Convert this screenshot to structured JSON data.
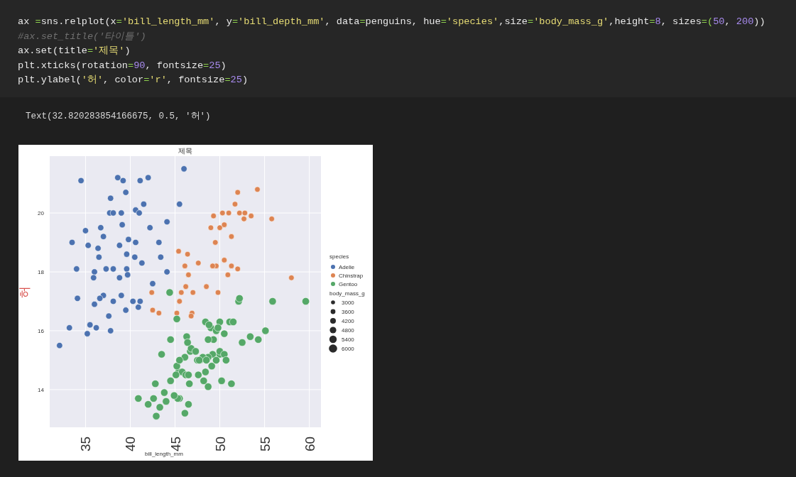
{
  "code_cell": {
    "lines": [
      [
        {
          "kind": "name",
          "text": "ax "
        },
        {
          "kind": "op",
          "text": "="
        },
        {
          "kind": "name",
          "text": "sns.relplot(x"
        },
        {
          "kind": "op",
          "text": "="
        },
        {
          "kind": "string",
          "text": "'bill_length_mm'"
        },
        {
          "kind": "name",
          "text": ", y"
        },
        {
          "kind": "op",
          "text": "="
        },
        {
          "kind": "string",
          "text": "'bill_depth_mm'"
        },
        {
          "kind": "name",
          "text": ", data"
        },
        {
          "kind": "op",
          "text": "="
        },
        {
          "kind": "name",
          "text": "penguins, hue"
        },
        {
          "kind": "op",
          "text": "="
        },
        {
          "kind": "string",
          "text": "'species'"
        },
        {
          "kind": "name",
          "text": ",size"
        },
        {
          "kind": "op",
          "text": "="
        },
        {
          "kind": "string",
          "text": "'body_mass_g'"
        },
        {
          "kind": "name",
          "text": ",height"
        },
        {
          "kind": "op",
          "text": "="
        },
        {
          "kind": "number",
          "text": "8"
        },
        {
          "kind": "name",
          "text": ", sizes"
        },
        {
          "kind": "op",
          "text": "=("
        },
        {
          "kind": "number",
          "text": "50"
        },
        {
          "kind": "name",
          "text": ", "
        },
        {
          "kind": "number",
          "text": "200"
        },
        {
          "kind": "name",
          "text": "))"
        }
      ],
      [
        {
          "kind": "comment",
          "text": "#ax.set_title('타이틀')"
        }
      ],
      [
        {
          "kind": "name",
          "text": "ax.set(title"
        },
        {
          "kind": "op",
          "text": "="
        },
        {
          "kind": "string",
          "text": "'제목'"
        },
        {
          "kind": "name",
          "text": ")"
        }
      ],
      [
        {
          "kind": "name",
          "text": "plt.xticks(rotation"
        },
        {
          "kind": "op",
          "text": "="
        },
        {
          "kind": "number",
          "text": "90"
        },
        {
          "kind": "name",
          "text": ", fontsize"
        },
        {
          "kind": "op",
          "text": "="
        },
        {
          "kind": "number",
          "text": "25"
        },
        {
          "kind": "name",
          "text": ")"
        }
      ],
      [
        {
          "kind": "name",
          "text": "plt.ylabel("
        },
        {
          "kind": "string",
          "text": "'허'"
        },
        {
          "kind": "name",
          "text": ", color"
        },
        {
          "kind": "op",
          "text": "="
        },
        {
          "kind": "string",
          "text": "'r'"
        },
        {
          "kind": "name",
          "text": ", fontsize"
        },
        {
          "kind": "op",
          "text": "="
        },
        {
          "kind": "number",
          "text": "25"
        },
        {
          "kind": "name",
          "text": ")"
        }
      ]
    ]
  },
  "output": {
    "text": "Text(32.820283854166675, 0.5, '허')"
  },
  "figure": {
    "chart_data": {
      "type": "scatter",
      "title": "제목",
      "xlabel": "bill_length_mm",
      "ylabel": "허",
      "xlim": [
        31,
        61.3
      ],
      "ylim": [
        12.72,
        21.93
      ],
      "xticks": [
        35,
        40,
        45,
        50,
        55,
        60
      ],
      "yticks": [
        14,
        16,
        18,
        20
      ],
      "grid": true,
      "legend": "right",
      "series": [
        {
          "name": "Adelie",
          "color": "#4c72b0",
          "x": [
            34.5,
            39.2,
            38.6,
            41.1,
            42,
            46,
            37.8,
            39.5,
            40.6,
            41.5,
            37.7,
            38.1,
            39,
            41,
            45.5,
            44.1,
            35,
            36.7,
            39.1,
            42.2,
            33.5,
            35.3,
            36.4,
            38.8,
            39.8,
            40.6,
            43.2,
            34,
            36,
            36.5,
            37.3,
            38.1,
            39.6,
            40.5,
            41.3,
            43.4,
            44.1,
            35.9,
            37,
            38.8,
            39.7,
            40.3,
            42.5,
            36,
            37.6,
            39.5,
            41.1,
            33.2,
            35.5,
            36.2,
            37.8,
            35.2,
            32.1,
            38.1,
            36.6,
            39,
            40.9,
            34.1,
            37,
            39.6
          ],
          "values": [
            21.1,
            21.1,
            21.2,
            21.1,
            21.2,
            21.5,
            20.5,
            20.7,
            20.1,
            20.3,
            20,
            20,
            20,
            20,
            20.3,
            19.7,
            19.4,
            19.5,
            19.6,
            19.5,
            19,
            18.9,
            18.8,
            18.9,
            19.1,
            19,
            19,
            18.1,
            18,
            18.5,
            18.1,
            18.1,
            18.1,
            18.5,
            18.3,
            18.5,
            18,
            17.8,
            17.2,
            17.8,
            17.9,
            17,
            17.6,
            16.9,
            16.5,
            16.7,
            17,
            16.1,
            16.2,
            16.1,
            16,
            15.9,
            15.5,
            17,
            17.1,
            17.2,
            16.8,
            17.1,
            19.2,
            18.6
          ]
        },
        {
          "name": "Chinstrap",
          "color": "#dd8452",
          "x": [
            46.5,
            50,
            51.3,
            52.7,
            45.4,
            46.1,
            51.3,
            52.2,
            54.2,
            49.6,
            47,
            50.5,
            49.5,
            46.4,
            52,
            50.5,
            49.2,
            46.9,
            58,
            55.8,
            52,
            51,
            50.9,
            45.2,
            42.5,
            43.2,
            46.2,
            48.5,
            50.3,
            49,
            52.8,
            47.6,
            45.7,
            51.7,
            53.5,
            49.8,
            42.4,
            45.5,
            46.8,
            49.3
          ],
          "values": [
            17.9,
            19.5,
            19.2,
            19.8,
            18.7,
            18.2,
            18.2,
            20,
            20.8,
            18.2,
            17.3,
            19.6,
            19,
            18.6,
            18.1,
            18.4,
            18.2,
            16.6,
            17.8,
            19.8,
            20.7,
            20,
            17.9,
            16.6,
            16.7,
            16.6,
            17.5,
            17.5,
            20,
            19.5,
            20,
            18.3,
            17.3,
            20.3,
            19.9,
            17.3,
            17.3,
            17,
            16.5,
            19.9
          ]
        },
        {
          "name": "Gentoo",
          "color": "#55a868",
          "x": [
            46.1,
            50,
            48.7,
            50,
            47.6,
            46.5,
            45.4,
            46.7,
            43.3,
            46.8,
            40.9,
            49,
            45.5,
            48.4,
            45.8,
            49.3,
            42,
            49.2,
            46.2,
            48.7,
            50.2,
            45.1,
            46.5,
            46.3,
            42.9,
            46.1,
            44.5,
            47.8,
            48.2,
            50,
            47.3,
            42.8,
            59.6,
            49.1,
            48.4,
            42.6,
            44.4,
            44,
            48.7,
            49.6,
            45.3,
            49.6,
            50.5,
            43.5,
            50.5,
            44.9,
            45.2,
            48.8,
            55.9,
            51.1,
            52.1,
            54.3,
            55.1,
            53.4,
            51.5,
            47.5,
            52.2,
            51.3,
            49.8,
            43.8,
            48.1,
            46.4,
            44.5,
            50.7,
            47.7,
            45.2,
            46.6,
            52.5,
            45.5,
            48.5
          ],
          "values": [
            13.2,
            16.3,
            14.1,
            15.2,
            14.5,
            13.5,
            14.6,
            15.3,
            13.4,
            15.4,
            13.7,
            16.1,
            13.7,
            14.6,
            14.6,
            15.7,
            13.5,
            15.2,
            14.5,
            15.1,
            14.3,
            14.5,
            14.5,
            15.8,
            13.1,
            15.1,
            14.3,
            15,
            14.3,
            15.3,
            15.3,
            14.2,
            17,
            14.8,
            16.3,
            13.7,
            17.3,
            13.6,
            15.7,
            16,
            13.7,
            15,
            15.9,
            15.2,
            15.2,
            13.8,
            16.4,
            16.2,
            17,
            16.3,
            17,
            15.7,
            16,
            15.8,
            16.3,
            15,
            17.1,
            14.2,
            16.1,
            13.9,
            15.1,
            15.6,
            15.7,
            15,
            15,
            14.8,
            14.2,
            15.6,
            15,
            15
          ]
        }
      ]
    },
    "legend": {
      "hue_title": "species",
      "size_title": "body_mass_g",
      "sizes": [
        "3000",
        "3600",
        "4200",
        "4800",
        "5400",
        "6000"
      ]
    }
  }
}
